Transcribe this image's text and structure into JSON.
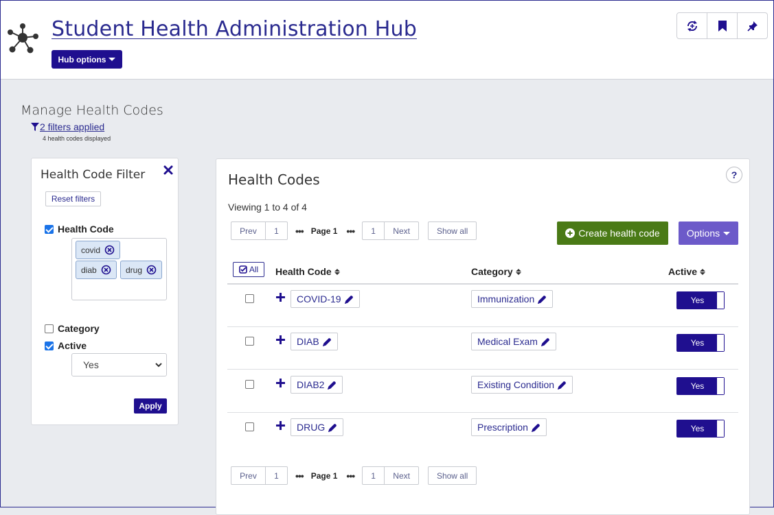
{
  "header": {
    "title": "Student Health Administration Hub",
    "hub_options_label": "Hub options",
    "tools": [
      "sync-icon",
      "bookmark-icon",
      "pin-icon"
    ]
  },
  "page": {
    "title": "Manage Health Codes",
    "filters_applied": "2 filters applied",
    "codes_displayed": "4 health codes displayed"
  },
  "filter_panel": {
    "title": "Health Code Filter",
    "reset_label": "Reset filters",
    "health_code": {
      "label": "Health Code",
      "checked": true,
      "tags": [
        "covid",
        "diab",
        "drug"
      ]
    },
    "category": {
      "label": "Category",
      "checked": false
    },
    "active": {
      "label": "Active",
      "checked": true,
      "selected": "Yes"
    },
    "apply_label": "Apply"
  },
  "main": {
    "title": "Health Codes",
    "help_label": "?",
    "viewing": "Viewing 1 to 4 of 4",
    "pager": {
      "prev": "Prev",
      "first_page": "1",
      "dots": "•••",
      "current": "Page 1",
      "last_page": "1",
      "next": "Next",
      "show_all": "Show all"
    },
    "create_label": "Create health code",
    "options_label": "Options",
    "select_all_label": "All",
    "columns": [
      "Health Code",
      "Category",
      "Active"
    ],
    "rows": [
      {
        "code": "COVID-19",
        "category": "Immunization",
        "active": "Yes"
      },
      {
        "code": "DIAB",
        "category": "Medical Exam",
        "active": "Yes"
      },
      {
        "code": "DIAB2",
        "category": "Existing Condition",
        "active": "Yes"
      },
      {
        "code": "DRUG",
        "category": "Prescription",
        "active": "Yes"
      }
    ]
  },
  "colors": {
    "brand": "#1f0f8f",
    "link": "#2a2a8f",
    "create": "#4a7a16",
    "options": "#6c5ac9",
    "tag_bg": "#dbe7f6"
  }
}
